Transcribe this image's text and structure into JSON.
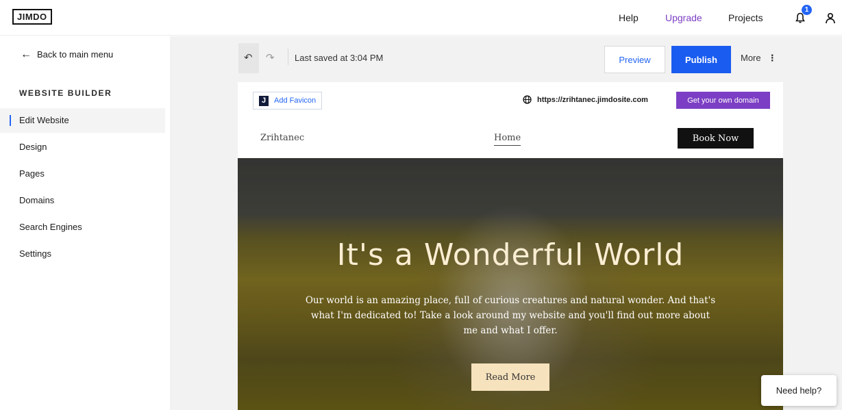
{
  "topbar": {
    "logo": "JIMDO",
    "help": "Help",
    "upgrade": "Upgrade",
    "projects": "Projects",
    "notification_count": "1",
    "icons": [
      "bell-icon",
      "user-icon"
    ]
  },
  "sidebar": {
    "back": "Back to main menu",
    "section_title": "WEBSITE BUILDER",
    "items": [
      {
        "label": "Edit Website",
        "active": true
      },
      {
        "label": "Design"
      },
      {
        "label": "Pages"
      },
      {
        "label": "Domains"
      },
      {
        "label": "Search Engines"
      },
      {
        "label": "Settings"
      }
    ]
  },
  "toolbar": {
    "last_saved": "Last saved at 3:04 PM",
    "preview": "Preview",
    "publish": "Publish",
    "more": "More",
    "icons": [
      "undo-icon",
      "redo-icon",
      "more-dots-icon"
    ]
  },
  "site": {
    "add_favicon": "Add Favicon",
    "favicon_letter": "J",
    "domain": "https://zrihtanec.jimdosite.com",
    "get_domain": "Get your own domain",
    "brand": "Zrihtanec",
    "nav_home": "Home",
    "book_now": "Book Now",
    "hero_title": "It's a Wonderful World",
    "hero_text": "Our world is an amazing place, full of curious creatures and natural wonder. And that's what I'm dedicated to! Take a look around my website and you'll find out more about me and what I offer.",
    "read_more": "Read More"
  },
  "help_widget": {
    "label": "Need help?"
  },
  "colors": {
    "accent_blue": "#1a5cf0",
    "upgrade_purple": "#7c3ec4",
    "hero_title": "#fbeed3",
    "read_more_bg": "#f6e2bd"
  }
}
